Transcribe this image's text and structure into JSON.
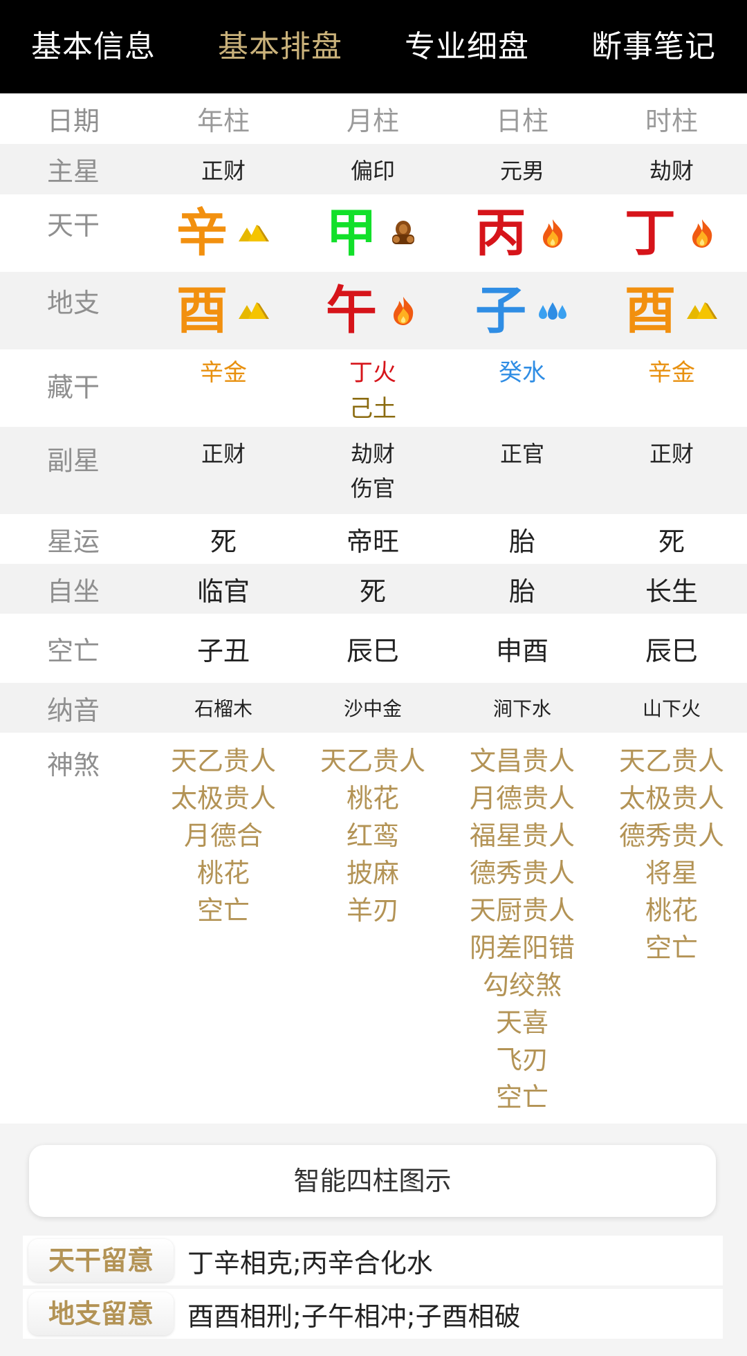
{
  "tabs": [
    {
      "label": "基本信息",
      "active": false
    },
    {
      "label": "基本排盘",
      "active": true
    },
    {
      "label": "专业细盘",
      "active": false
    },
    {
      "label": "断事笔记",
      "active": false
    }
  ],
  "labels": {
    "date": "日期",
    "main_star": "主星",
    "stem": "天干",
    "branch": "地支",
    "hidden": "藏干",
    "sub_star": "副星",
    "xingyun": "星运",
    "zizuo": "自坐",
    "kongwang": "空亡",
    "nayin": "纳音",
    "shensha": "神煞"
  },
  "columns": [
    {
      "header": "年柱",
      "main_star": "正财",
      "stem": {
        "char": "辛",
        "color": "#f2900f",
        "element_icon": "gold-nugget-icon"
      },
      "branch": {
        "char": "酉",
        "color": "#f2900f",
        "element_icon": "gold-nugget-icon"
      },
      "hidden": [
        {
          "text": "辛金",
          "color": "#e8900f"
        }
      ],
      "sub_star": [
        "正财"
      ],
      "xingyun": "死",
      "zizuo": "临官",
      "kongwang": "子丑",
      "nayin": "石榴木",
      "shensha": [
        "天乙贵人",
        "太极贵人",
        "月德合",
        "桃花",
        "空亡"
      ]
    },
    {
      "header": "月柱",
      "main_star": "偏印",
      "stem": {
        "char": "甲",
        "color": "#12e02a",
        "element_icon": "wood-log-icon"
      },
      "branch": {
        "char": "午",
        "color": "#d6141a",
        "element_icon": "fire-icon"
      },
      "hidden": [
        {
          "text": "丁火",
          "color": "#d6141a"
        },
        {
          "text": "己土",
          "color": "#8b6b10"
        }
      ],
      "sub_star": [
        "劫财",
        "伤官"
      ],
      "xingyun": "帝旺",
      "zizuo": "死",
      "kongwang": "辰巳",
      "nayin": "沙中金",
      "shensha": [
        "天乙贵人",
        "桃花",
        "红鸾",
        "披麻",
        "羊刃"
      ]
    },
    {
      "header": "日柱",
      "main_star": "元男",
      "stem": {
        "char": "丙",
        "color": "#d6141a",
        "element_icon": "fire-icon"
      },
      "branch": {
        "char": "子",
        "color": "#2f8de4",
        "element_icon": "water-drops-icon"
      },
      "hidden": [
        {
          "text": "癸水",
          "color": "#2f8de4"
        }
      ],
      "sub_star": [
        "正官"
      ],
      "xingyun": "胎",
      "zizuo": "胎",
      "kongwang": "申酉",
      "nayin": "涧下水",
      "shensha": [
        "文昌贵人",
        "月德贵人",
        "福星贵人",
        "德秀贵人",
        "天厨贵人",
        "阴差阳错",
        "勾绞煞",
        "天喜",
        "飞刃",
        "空亡"
      ]
    },
    {
      "header": "时柱",
      "main_star": "劫财",
      "stem": {
        "char": "丁",
        "color": "#d6141a",
        "element_icon": "fire-icon"
      },
      "branch": {
        "char": "酉",
        "color": "#f2900f",
        "element_icon": "gold-nugget-icon"
      },
      "hidden": [
        {
          "text": "辛金",
          "color": "#e8900f"
        }
      ],
      "sub_star": [
        "正财"
      ],
      "xingyun": "死",
      "zizuo": "长生",
      "kongwang": "辰巳",
      "nayin": "山下火",
      "shensha": [
        "天乙贵人",
        "太极贵人",
        "德秀贵人",
        "将星",
        "桃花",
        "空亡"
      ]
    }
  ],
  "smart_button": "智能四柱图示",
  "notes": [
    {
      "tag": "天干留意",
      "text": "丁辛相克;丙辛合化水"
    },
    {
      "tag": "地支留意",
      "text": "酉酉相刑;子午相冲;子酉相破"
    }
  ],
  "colors": {
    "accent_gold": "#b39355",
    "tab_active": "#c9b17a"
  }
}
